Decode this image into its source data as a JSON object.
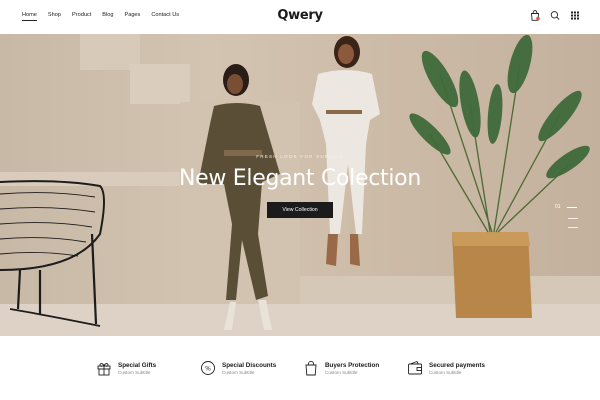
{
  "header": {
    "brand": "Qwery",
    "nav": [
      {
        "label": "Home",
        "active": true
      },
      {
        "label": "Shop"
      },
      {
        "label": "Product"
      },
      {
        "label": "Blog"
      },
      {
        "label": "Pages"
      },
      {
        "label": "Contact Us"
      }
    ],
    "icons": [
      "bag-icon",
      "search-icon",
      "grid-menu-icon"
    ],
    "cart_dot_color": "#e5553a"
  },
  "hero": {
    "kicker": "FRESH LOOK FOR SUMMER",
    "title": "New Elegant Colection",
    "cta": "View Collection",
    "slide_number": "01"
  },
  "features": [
    {
      "icon": "gift-icon",
      "title": "Special Gifts",
      "subtitle": "Custom Subtitle"
    },
    {
      "icon": "discount-icon",
      "title": "Special Discounts",
      "subtitle": "Custom Subtitle"
    },
    {
      "icon": "shopping-bag-icon",
      "title": "Buyers Protection",
      "subtitle": "Custom Subtitle"
    },
    {
      "icon": "wallet-icon",
      "title": "Secured payments",
      "subtitle": "Custom Subtitle"
    }
  ]
}
